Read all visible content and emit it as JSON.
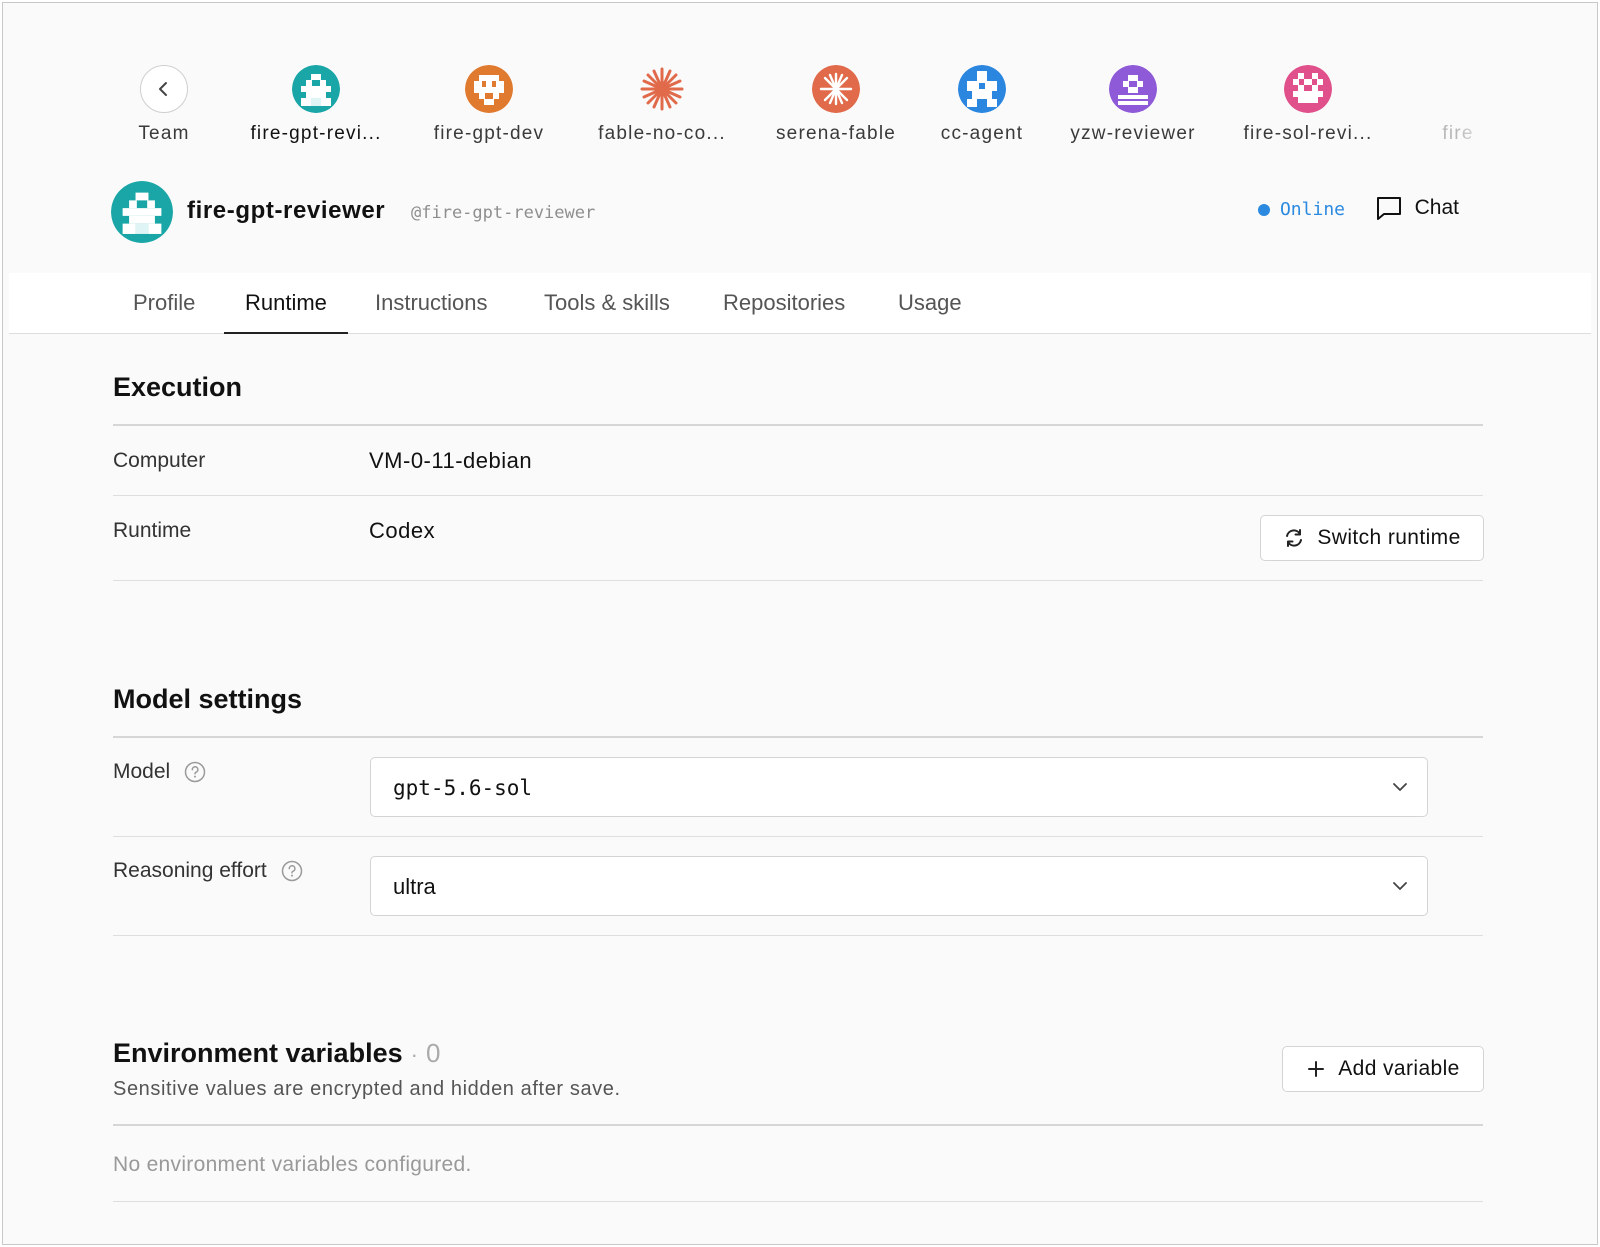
{
  "agent_strip": {
    "back_label": "Team",
    "agents": [
      {
        "label": "fire-gpt-revi...",
        "color": "#1aa6a6",
        "icon": "robot-avatar-icon",
        "active": true
      },
      {
        "label": "fire-gpt-dev",
        "color": "#e07a2e",
        "icon": "invader-avatar-icon"
      },
      {
        "label": "fable-no-co...",
        "color": "#e06a4a",
        "icon": "starburst-icon"
      },
      {
        "label": "serena-fable",
        "color": "#e06a4a",
        "icon": "starburst-badge-icon"
      },
      {
        "label": "cc-agent",
        "color": "#2b86e0",
        "icon": "plus-avatar-icon"
      },
      {
        "label": "yzw-reviewer",
        "color": "#8e5ad8",
        "icon": "checker-avatar-icon"
      },
      {
        "label": "fire-sol-revi...",
        "color": "#e0508a",
        "icon": "checker-avatar-icon"
      },
      {
        "label": "fire",
        "color": "#999999",
        "icon": "robot-avatar-icon"
      }
    ]
  },
  "header": {
    "name": "fire-gpt-reviewer",
    "handle": "@fire-gpt-reviewer",
    "status": "Online",
    "status_color": "#2b8ae0",
    "chat_label": "Chat"
  },
  "tabs": [
    {
      "label": "Profile"
    },
    {
      "label": "Runtime",
      "active": true
    },
    {
      "label": "Instructions"
    },
    {
      "label": "Tools & skills"
    },
    {
      "label": "Repositories"
    },
    {
      "label": "Usage"
    }
  ],
  "execution": {
    "title": "Execution",
    "computer_label": "Computer",
    "computer_value": "VM-0-11-debian",
    "runtime_label": "Runtime",
    "runtime_value": "Codex",
    "switch_label": "Switch runtime"
  },
  "model_settings": {
    "title": "Model settings",
    "model_label": "Model",
    "model_value": "gpt-5.6-sol",
    "effort_label": "Reasoning effort",
    "effort_value": "ultra"
  },
  "env": {
    "title": "Environment variables",
    "separator": "·",
    "count": "0",
    "subtitle": "Sensitive values are encrypted and hidden after save.",
    "add_label": "Add variable",
    "empty_text": "No environment variables configured."
  }
}
